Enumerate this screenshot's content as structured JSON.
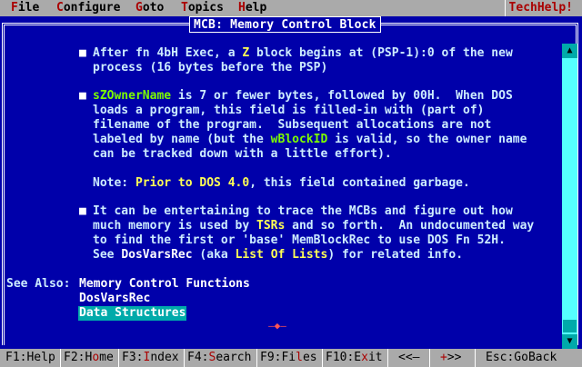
{
  "menubar": {
    "items": [
      {
        "hot": "F",
        "rest": "ile"
      },
      {
        "hot": "C",
        "rest": "onfigure"
      },
      {
        "hot": "G",
        "rest": "oto"
      },
      {
        "hot": "T",
        "rest": "opics"
      },
      {
        "hot": "H",
        "rest": "elp"
      }
    ],
    "brand": "TechHelp!"
  },
  "window": {
    "title": "MCB: Memory Control Block"
  },
  "content": {
    "p1_l1_a": "After fn 4bH Exec, a ",
    "p1_l1_hl": "Z",
    "p1_l1_b": " block begins at (PSP-1):0 of the new",
    "p1_l2": "process (16 bytes before the PSP)",
    "p2_l1_hl": "sZOwnerName",
    "p2_l1_b": " is 7 or fewer bytes, followed by 00H.  When DOS",
    "p2_l2": "loads a program, this field is filled-in with (part of)",
    "p2_l3": "filename of the program.  Subsequent allocations are not",
    "p2_l4_a": "labeled by name (but the ",
    "p2_l4_hl": "wBlockID",
    "p2_l4_b": " is valid, so the owner name",
    "p2_l5": "can be tracked down with a little effort).",
    "note_a": "Note: ",
    "note_hl": "Prior to DOS 4.0",
    "note_b": ", this field contained garbage.",
    "p3_l1": "It can be entertaining to trace the MCBs and figure out how",
    "p3_l2_a": "much memory is used by ",
    "p3_l2_hl": "TSRs",
    "p3_l2_b": " and so forth.  An undocumented way",
    "p3_l3": "to find the first or 'base' MemBlockRec to use DOS Fn 52H.",
    "p3_l4_a": "See ",
    "p3_l4_hl1": "DosVarsRec",
    "p3_l4_b": " (aka ",
    "p3_l4_hl2": "List Of Lists",
    "p3_l4_c": ") for related info.",
    "bullet": "■"
  },
  "see_also": {
    "label": "See Also:",
    "links": [
      "Memory Control Functions",
      "DosVarsRec",
      "Data Structures"
    ]
  },
  "scroll_marker": "–◆–",
  "fbar": {
    "keys": [
      {
        "a": "F1:",
        "hot": "",
        "b": "Help"
      },
      {
        "a": "F2:H",
        "hot": "o",
        "b": "me"
      },
      {
        "a": "F3:",
        "hot": "I",
        "b": "ndex"
      },
      {
        "a": "F4:",
        "hot": "S",
        "b": "earch"
      },
      {
        "a": "F9:Fi",
        "hot": "l",
        "b": "es"
      },
      {
        "a": "F10:E",
        "hot": "x",
        "b": "it"
      },
      {
        "a": "<<–",
        "hot": "",
        "b": ""
      },
      {
        "a": "",
        "hot": "+",
        "b": ">>"
      },
      {
        "a": "Esc:GoBack",
        "hot": "",
        "b": ""
      }
    ]
  }
}
